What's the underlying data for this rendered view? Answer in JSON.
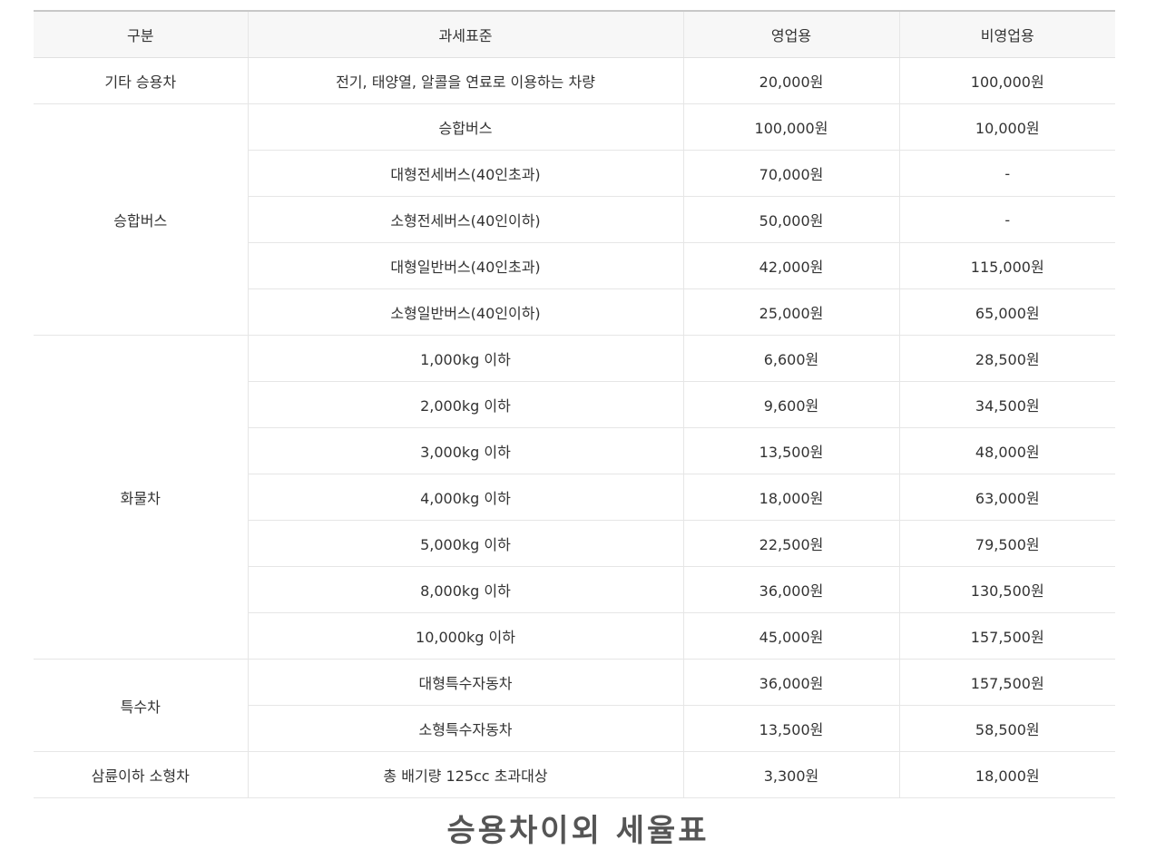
{
  "headers": [
    "구분",
    "과세표준",
    "영업용",
    "비영업용"
  ],
  "groups": [
    {
      "category": "기타 승용차",
      "rows": [
        {
          "standard": "전기, 태양열, 알콜을 연료로 이용하는 차량",
          "business": "20,000원",
          "nonbusiness": "100,000원"
        }
      ]
    },
    {
      "category": "승합버스",
      "rows": [
        {
          "standard": "승합버스",
          "business": "100,000원",
          "nonbusiness": "10,000원"
        },
        {
          "standard": "대형전세버스(40인초과)",
          "business": "70,000원",
          "nonbusiness": "-"
        },
        {
          "standard": "소형전세버스(40인이하)",
          "business": "50,000원",
          "nonbusiness": "-"
        },
        {
          "standard": "대형일반버스(40인초과)",
          "business": "42,000원",
          "nonbusiness": "115,000원"
        },
        {
          "standard": "소형일반버스(40인이하)",
          "business": "25,000원",
          "nonbusiness": "65,000원"
        }
      ]
    },
    {
      "category": "화물차",
      "rows": [
        {
          "standard": "1,000kg 이하",
          "business": "6,600원",
          "nonbusiness": "28,500원"
        },
        {
          "standard": "2,000kg 이하",
          "business": "9,600원",
          "nonbusiness": "34,500원"
        },
        {
          "standard": "3,000kg 이하",
          "business": "13,500원",
          "nonbusiness": "48,000원"
        },
        {
          "standard": "4,000kg 이하",
          "business": "18,000원",
          "nonbusiness": "63,000원"
        },
        {
          "standard": "5,000kg 이하",
          "business": "22,500원",
          "nonbusiness": "79,500원"
        },
        {
          "standard": "8,000kg 이하",
          "business": "36,000원",
          "nonbusiness": "130,500원"
        },
        {
          "standard": "10,000kg 이하",
          "business": "45,000원",
          "nonbusiness": "157,500원"
        }
      ]
    },
    {
      "category": "특수차",
      "rows": [
        {
          "standard": "대형특수자동차",
          "business": "36,000원",
          "nonbusiness": "157,500원"
        },
        {
          "standard": "소형특수자동차",
          "business": "13,500원",
          "nonbusiness": "58,500원"
        }
      ]
    },
    {
      "category": "삼륜이하 소형차",
      "rows": [
        {
          "standard": "총 배기량 125cc 초과대상",
          "business": "3,300원",
          "nonbusiness": "18,000원"
        }
      ]
    }
  ],
  "caption": "승용차이외 세율표"
}
